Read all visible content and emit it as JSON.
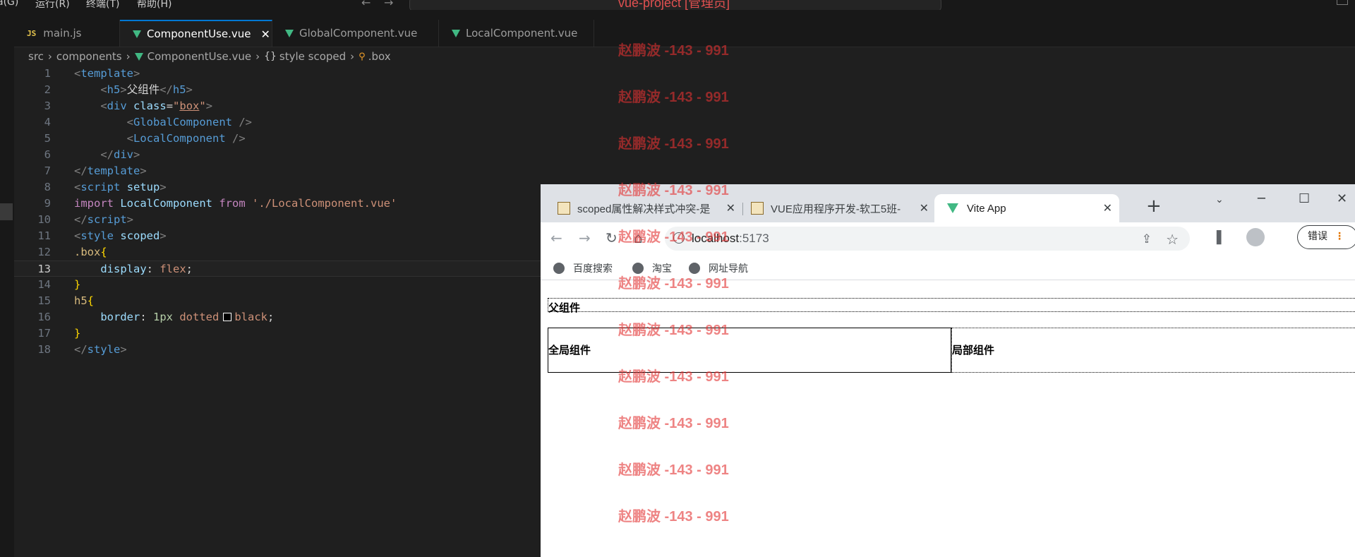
{
  "menu": {
    "items": [
      "a(G)",
      "运行(R)",
      "终端(T)",
      "帮助(H)"
    ],
    "title": "vue-project [管理员]"
  },
  "editor_tabs": [
    {
      "label": "main.js",
      "kind": "js"
    },
    {
      "label": "ComponentUse.vue",
      "kind": "vue",
      "active": true
    },
    {
      "label": "GlobalComponent.vue",
      "kind": "vue"
    },
    {
      "label": "LocalComponent.vue",
      "kind": "vue"
    }
  ],
  "breadcrumb": {
    "src": "src",
    "components": "components",
    "file": "ComponentUse.vue",
    "block": "style scoped",
    "symbol": ".box"
  },
  "code": {
    "lines": [
      "1",
      "2",
      "3",
      "4",
      "5",
      "6",
      "7",
      "8",
      "9",
      "10",
      "11",
      "12",
      "13",
      "14",
      "15",
      "16",
      "17",
      "18"
    ]
  },
  "browser": {
    "tabs": [
      {
        "label": "scoped属性解决样式冲突-是"
      },
      {
        "label": "VUE应用程序开发-软工5班-"
      },
      {
        "label": "Vite App"
      }
    ],
    "url_host": "localhost",
    "url_port": ":5173",
    "error_label": "错误",
    "bookmarks": [
      "百度搜索",
      "淘宝",
      "网址导航"
    ],
    "page": {
      "parent": "父组件",
      "global": "全局组件",
      "local": "局部组件"
    }
  },
  "watermark": {
    "text": "赵鹏波 -143 - 991"
  }
}
